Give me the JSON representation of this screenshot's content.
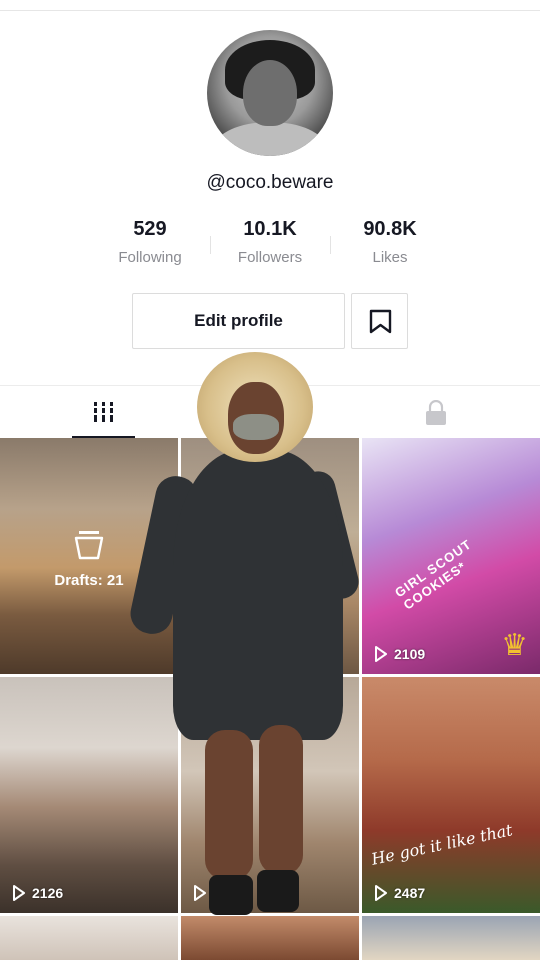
{
  "profile": {
    "username": "@coco.beware",
    "stats": [
      {
        "value": "529",
        "label": "Following"
      },
      {
        "value": "10.1K",
        "label": "Followers"
      },
      {
        "value": "90.8K",
        "label": "Likes"
      }
    ],
    "edit_label": "Edit profile"
  },
  "tabs": {
    "videos_icon": "grid-icon",
    "private_icon": "lock-icon"
  },
  "videos": {
    "drafts_label": "Drafts: 21",
    "items": [
      {
        "views": "2109",
        "caption": "GIRL SCOUT COOKIES*"
      },
      {
        "views": "2126"
      },
      {
        "views": ""
      },
      {
        "views": "2487",
        "caption": "He got it like that"
      }
    ]
  }
}
